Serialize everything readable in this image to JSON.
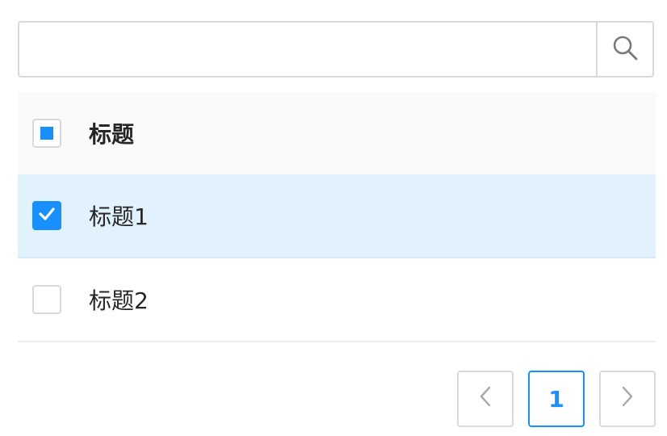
{
  "search": {
    "value": "",
    "placeholder": "",
    "icon": "search-icon"
  },
  "table": {
    "header": {
      "title": "标题",
      "checkbox_state": "indeterminate"
    },
    "rows": [
      {
        "title": "标题1",
        "checked": true
      },
      {
        "title": "标题2",
        "checked": false
      }
    ]
  },
  "pagination": {
    "prev_icon": "chevron-left-icon",
    "current_page": "1",
    "next_icon": "chevron-right-icon"
  },
  "colors": {
    "accent": "#1890ff",
    "selected_row_bg": "#e1f2fc",
    "header_bg": "#fafafa",
    "border": "#d9d9d9"
  }
}
